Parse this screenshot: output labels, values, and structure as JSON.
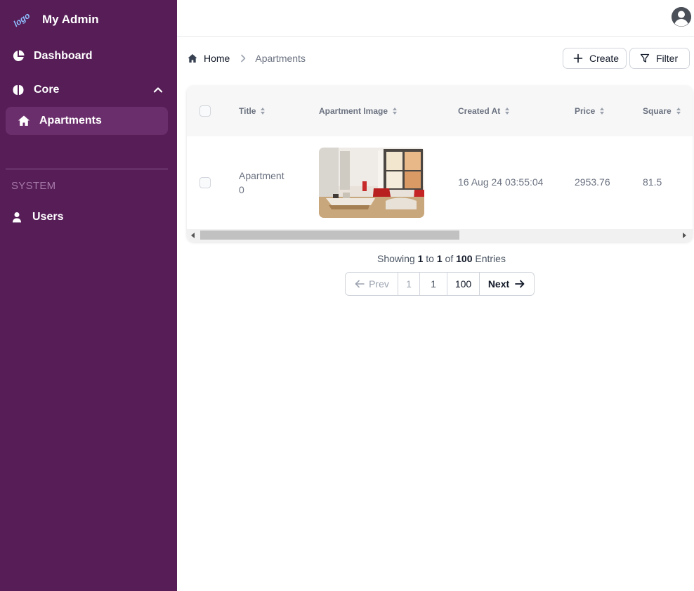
{
  "brand": {
    "logo_text": "logo",
    "title": "My Admin"
  },
  "sidebar": {
    "items": [
      {
        "label": "Dashboard",
        "icon": "pie-chart-icon"
      },
      {
        "label": "Core",
        "icon": "brain-icon",
        "expanded": true
      },
      {
        "label": "Apartments",
        "icon": "home-icon",
        "active": true
      },
      {
        "label": "Users",
        "icon": "user-icon"
      }
    ],
    "section_label": "SYSTEM"
  },
  "header": {
    "avatar_icon": "user-avatar-icon"
  },
  "breadcrumb": {
    "home": "Home",
    "current": "Apartments"
  },
  "actions": {
    "create_label": "Create",
    "filter_label": "Filter"
  },
  "table": {
    "columns": [
      "Title",
      "Apartment Image",
      "Created At",
      "Price",
      "Square"
    ],
    "rows": [
      {
        "title_line1": "Apartment",
        "title_line2": "0",
        "created_at": "16 Aug 24 03:55:04",
        "price": "2953.76",
        "square": "81.5"
      }
    ]
  },
  "pagination": {
    "showing_prefix": "Showing",
    "from": "1",
    "to_word": "to",
    "to": "1",
    "of_word": "of",
    "total": "100",
    "suffix": "Entries",
    "prev_label": "Prev",
    "pages": [
      "1",
      "1",
      "100"
    ],
    "next_label": "Next"
  },
  "colors": {
    "sidebar_bg": "#561d57",
    "sidebar_active": "#6b2e6c",
    "logo": "#8fc1ff"
  }
}
